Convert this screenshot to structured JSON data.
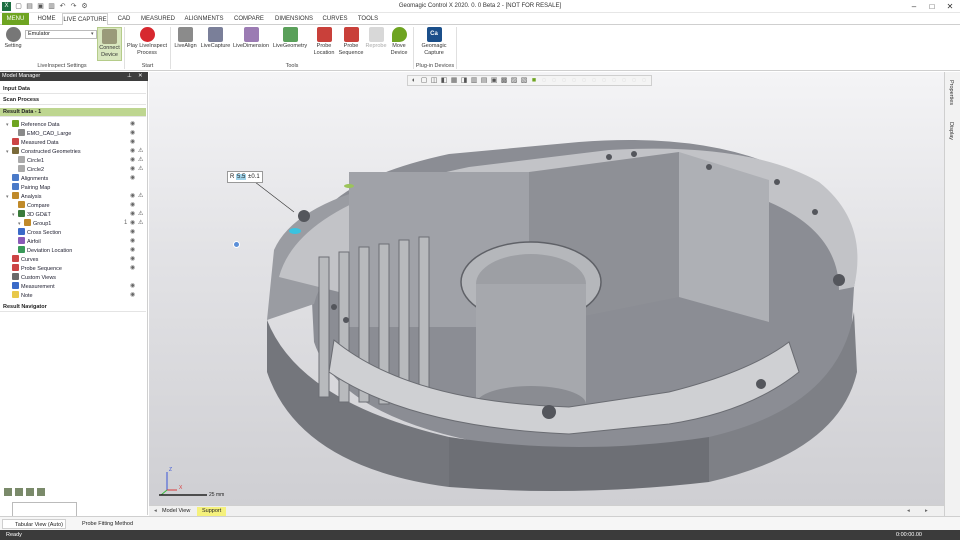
{
  "window": {
    "title": "Geomagic Control X 2020. 0. 0 Beta 2 - [NOT FOR RESALE]"
  },
  "tabs": [
    "MENU",
    "HOME",
    "LIVE CAPTURE",
    "CAD",
    "MEASURED",
    "ALIGNMENTS",
    "COMPARE",
    "DIMENSIONS",
    "CURVES",
    "TOOLS"
  ],
  "active_tab": "LIVE CAPTURE",
  "ribbon": {
    "setting": "Setting",
    "device_select": "Emulator",
    "connect": [
      "Connect",
      "Device"
    ],
    "play": [
      "Play LiveInspect",
      "Process"
    ],
    "tools": [
      "LiveAlign",
      "LiveCapture",
      "LiveDimension",
      "LiveGeometry"
    ],
    "probe_location": [
      "Probe",
      "Location"
    ],
    "probe_sequence": [
      "Probe",
      "Sequence"
    ],
    "reprobe": "Reprobe",
    "move_device": [
      "Move",
      "Device"
    ],
    "capture": [
      "Geomagic",
      "Capture"
    ],
    "capture_icon_text": "Ca",
    "groups": [
      "LiveInspect Settings",
      "Start",
      "Tools",
      "Plug-in Devices"
    ]
  },
  "model_manager": {
    "title": "Model Manager",
    "sections": [
      "Input Data",
      "Scan Process",
      "Result Data - 1"
    ],
    "tree": [
      {
        "label": "Reference Data",
        "eye": true,
        "warn": false
      },
      {
        "label": "EMO_CAD_Large",
        "eye": true,
        "warn": false
      },
      {
        "label": "Measured Data",
        "eye": true,
        "warn": false
      },
      {
        "label": "Constructed Geometries",
        "eye": true,
        "warn": true
      },
      {
        "label": "Circle1",
        "eye": true,
        "warn": true
      },
      {
        "label": "Circle2",
        "eye": true,
        "warn": true
      },
      {
        "label": "Alignments",
        "eye": true,
        "warn": false
      },
      {
        "label": "Pairing Map",
        "eye": false,
        "warn": false
      },
      {
        "label": "Analysis",
        "eye": true,
        "warn": true
      },
      {
        "label": "Compare",
        "eye": true,
        "warn": false
      },
      {
        "label": "3D GD&T",
        "eye": true,
        "warn": true
      },
      {
        "label": "Group1",
        "eye": true,
        "warn": true,
        "badge": "1"
      },
      {
        "label": "Cross Section",
        "eye": true,
        "warn": false
      },
      {
        "label": "Airfoil",
        "eye": true,
        "warn": false
      },
      {
        "label": "Deviation Location",
        "eye": true,
        "warn": false
      },
      {
        "label": "Curves",
        "eye": true,
        "warn": false
      },
      {
        "label": "Probe Sequence",
        "eye": true,
        "warn": false
      },
      {
        "label": "Custom Views",
        "eye": false,
        "warn": false
      },
      {
        "label": "Measurement",
        "eye": true,
        "warn": false
      },
      {
        "label": "Note",
        "eye": true,
        "warn": false
      }
    ],
    "navigator": "Result Navigator"
  },
  "viewport": {
    "callout_prefix": "R",
    "callout_value": "5.5",
    "callout_suffix": "±0.1",
    "scale": "25 mm",
    "axis_x": "X",
    "axis_y": "Y",
    "axis_z": "Z"
  },
  "right_tabs": [
    "Properties",
    "Display"
  ],
  "bottom_tabs": [
    "Model View",
    "Support"
  ],
  "bottom_panels": [
    "Tabular View (Auto)",
    "Probe Fitting Method"
  ],
  "status": {
    "left": "Ready",
    "time": "0:00:00.00"
  },
  "colors": {
    "accent": "#6ea421",
    "highlight": "#bed690",
    "model": "#8d8f96",
    "status_bar": "#3b3b3b"
  }
}
